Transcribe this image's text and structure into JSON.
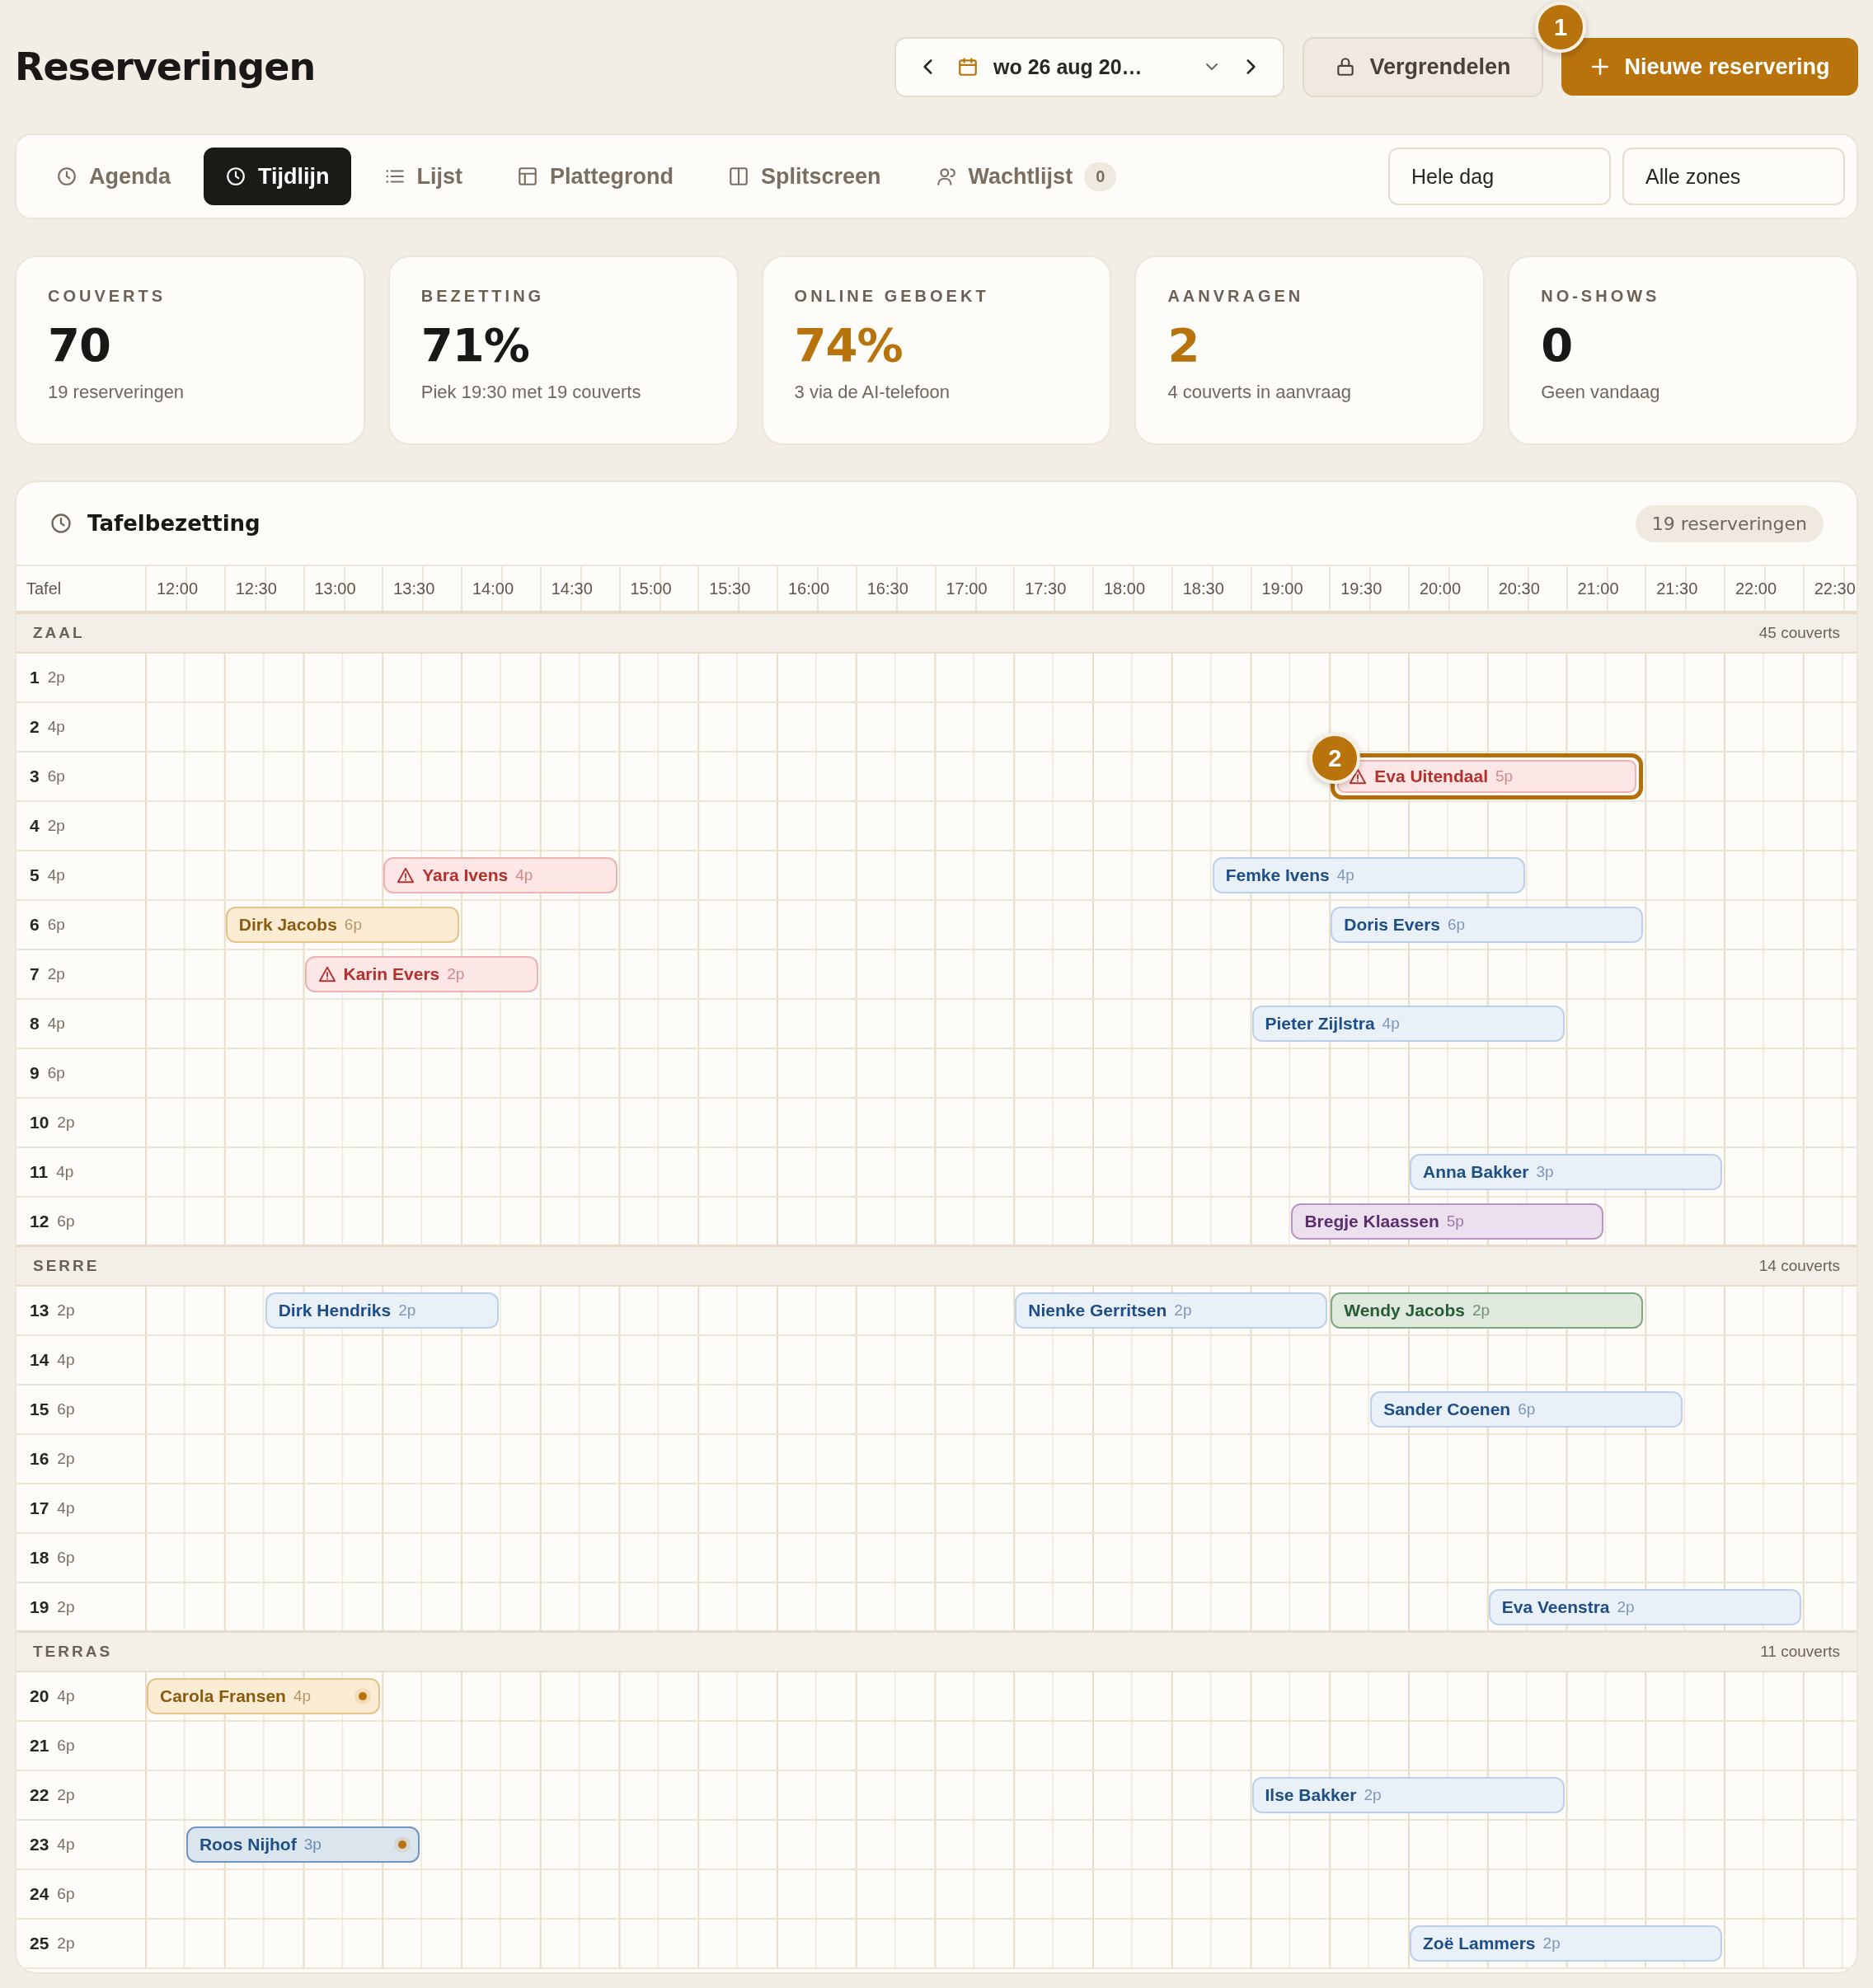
{
  "header": {
    "title": "Reserveringen",
    "date": "wo 26 aug 20…",
    "lock_button": "Vergrendelen",
    "new_button": {
      "label": "Nieuwe reservering",
      "marker": "1"
    }
  },
  "tabs": [
    {
      "label": "Agenda",
      "selected": false
    },
    {
      "label": "Tijdlijn",
      "selected": true
    },
    {
      "label": "Lijst",
      "selected": false
    },
    {
      "label": "Plattegrond",
      "selected": false
    },
    {
      "label": "Splitscreen",
      "selected": false
    },
    {
      "label": "Wachtlijst",
      "selected": false,
      "count": "0"
    }
  ],
  "filters": [
    "Hele dag",
    "Alle zones"
  ],
  "stats": [
    {
      "label": "COUVERTS",
      "value": "70",
      "note": "19 reserveringen",
      "highlight": false
    },
    {
      "label": "BEZETTING",
      "value": "71%",
      "note": "Piek 19:30 met 19 couverts",
      "highlight": false
    },
    {
      "label": "ONLINE GEBOEKT",
      "value": "74%",
      "note": "3 via de AI-telefoon",
      "highlight": true
    },
    {
      "label": "AANVRAGEN",
      "value": "2",
      "note": "4 couverts in aanvraag",
      "highlight": true
    },
    {
      "label": "NO-SHOWS",
      "value": "0",
      "note": "Geen vandaag",
      "highlight": false
    }
  ],
  "timeline": {
    "title": "Tafelbezetting",
    "count": "19 reserveringen",
    "table_heading": "Tafel",
    "times": [
      "12:00",
      "12:30",
      "13:00",
      "13:30",
      "14:00",
      "14:30",
      "15:00",
      "15:30",
      "16:00",
      "16:30",
      "17:00",
      "17:30",
      "18:00",
      "18:30",
      "19:00",
      "19:30",
      "20:00",
      "20:30",
      "21:00",
      "21:30",
      "22:00",
      "22:30"
    ],
    "sections": [
      {
        "name": "ZAAL",
        "covers": "45 couverts",
        "tables": [
          {
            "number": "1",
            "seats": "2p"
          },
          {
            "number": "2",
            "seats": "4p"
          },
          {
            "number": "3",
            "seats": "6p",
            "reservations": [
              {
                "name": "Eva Uitendaal",
                "size": "5p",
                "kind": "conflict",
                "dot": false,
                "focused": true,
                "marker": "2"
              }
            ]
          },
          {
            "number": "4",
            "seats": "2p"
          },
          {
            "number": "5",
            "seats": "4p",
            "reservations": [
              {
                "name": "Yara Ivens",
                "size": "4p",
                "kind": "conflict",
                "dot": false,
                "focused": false
              },
              {
                "name": "Femke Ivens",
                "size": "4p",
                "kind": "confirmed",
                "dot": false,
                "focused": false
              }
            ]
          },
          {
            "number": "6",
            "seats": "6p",
            "reservations": [
              {
                "name": "Dirk Jacobs",
                "size": "6p",
                "kind": "pending",
                "dot": false,
                "focused": false
              },
              {
                "name": "Doris Evers",
                "size": "6p",
                "kind": "confirmed",
                "dot": false,
                "focused": false
              }
            ]
          },
          {
            "number": "7",
            "seats": "2p",
            "reservations": [
              {
                "name": "Karin Evers",
                "size": "2p",
                "kind": "conflict",
                "dot": false,
                "focused": false
              }
            ]
          },
          {
            "number": "8",
            "seats": "4p",
            "reservations": [
              {
                "name": "Pieter Zijlstra",
                "size": "4p",
                "kind": "confirmed",
                "dot": false,
                "focused": false
              }
            ]
          },
          {
            "number": "9",
            "seats": "6p"
          },
          {
            "number": "10",
            "seats": "2p"
          },
          {
            "number": "11",
            "seats": "4p",
            "reservations": [
              {
                "name": "Anna Bakker",
                "size": "3p",
                "kind": "confirmed",
                "dot": false,
                "focused": false
              }
            ]
          },
          {
            "number": "12",
            "seats": "6p",
            "reservations": [
              {
                "name": "Bregje Klaassen",
                "size": "5p",
                "kind": "request",
                "dot": false,
                "focused": false
              }
            ]
          }
        ]
      },
      {
        "name": "SERRE",
        "covers": "14 couverts",
        "tables": [
          {
            "number": "13",
            "seats": "2p",
            "reservations": [
              {
                "name": "Dirk Hendriks",
                "size": "2p",
                "kind": "confirmed",
                "dot": false,
                "focused": false
              },
              {
                "name": "Nienke Gerritsen",
                "size": "2p",
                "kind": "confirmed",
                "dot": false,
                "focused": false
              },
              {
                "name": "Wendy Jacobs",
                "size": "2p",
                "kind": "seated",
                "dot": false,
                "focused": false
              }
            ]
          },
          {
            "number": "14",
            "seats": "4p"
          },
          {
            "number": "15",
            "seats": "6p",
            "reservations": [
              {
                "name": "Sander Coenen",
                "size": "6p",
                "kind": "confirmed",
                "dot": false,
                "focused": false
              }
            ]
          },
          {
            "number": "16",
            "seats": "2p"
          },
          {
            "number": "17",
            "seats": "4p"
          },
          {
            "number": "18",
            "seats": "6p"
          },
          {
            "number": "19",
            "seats": "2p",
            "reservations": [
              {
                "name": "Eva Veenstra",
                "size": "2p",
                "kind": "confirmed",
                "dot": false,
                "focused": false
              }
            ]
          }
        ]
      },
      {
        "name": "TERRAS",
        "covers": "11 couverts",
        "tables": [
          {
            "number": "20",
            "seats": "4p",
            "reservations": [
              {
                "name": "Carola Fransen",
                "size": "4p",
                "kind": "pending",
                "dot": true,
                "focused": false
              }
            ]
          },
          {
            "number": "21",
            "seats": "6p"
          },
          {
            "number": "22",
            "seats": "2p",
            "reservations": [
              {
                "name": "Ilse Bakker",
                "size": "2p",
                "kind": "confirmed",
                "dot": false,
                "focused": false
              }
            ]
          },
          {
            "number": "23",
            "seats": "4p",
            "reservations": [
              {
                "name": "Roos Nijhof",
                "size": "3p",
                "kind": "arrived",
                "dot": true,
                "focused": false
              }
            ]
          },
          {
            "number": "24",
            "seats": "6p"
          },
          {
            "number": "25",
            "seats": "2p",
            "reservations": [
              {
                "name": "Zoë Lammers",
                "size": "2p",
                "kind": "confirmed",
                "dot": false,
                "focused": false
              }
            ]
          }
        ]
      }
    ]
  }
}
